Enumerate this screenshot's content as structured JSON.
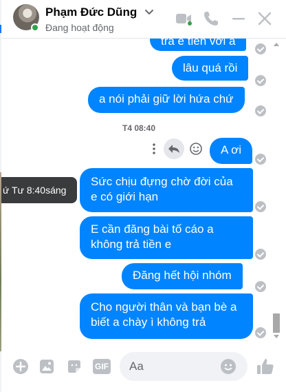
{
  "header": {
    "contact_name": "Phạm Đức Dũng",
    "status": "Đang hoạt động",
    "icons": [
      "video-call-icon",
      "voice-call-icon",
      "minimize-icon",
      "close-icon"
    ]
  },
  "tooltip": {
    "text": "ứ Tư 8:40sáng"
  },
  "messages": {
    "timestamp": "T4 08:40",
    "items": [
      {
        "text": "trả e tiền với a"
      },
      {
        "text": "lâu quá rồi"
      },
      {
        "text": "a nói phải giữ lời hứa chứ"
      },
      {
        "text": "A ơi"
      },
      {
        "text": "Sức chịu đựng chờ đời của e có giới hạn"
      },
      {
        "text": "E cần đăng bài tố cáo a không trả tiền e"
      },
      {
        "text": "Đăng hết hội nhóm"
      },
      {
        "text": "Cho người thân và bạn bè a biết a chày ì không trả"
      }
    ]
  },
  "composer": {
    "placeholder": "Aa",
    "gif_label": "GIF"
  },
  "colors": {
    "brand": "#0084ff",
    "icon_blue": "#0a7cff",
    "online": "#31a24c"
  }
}
